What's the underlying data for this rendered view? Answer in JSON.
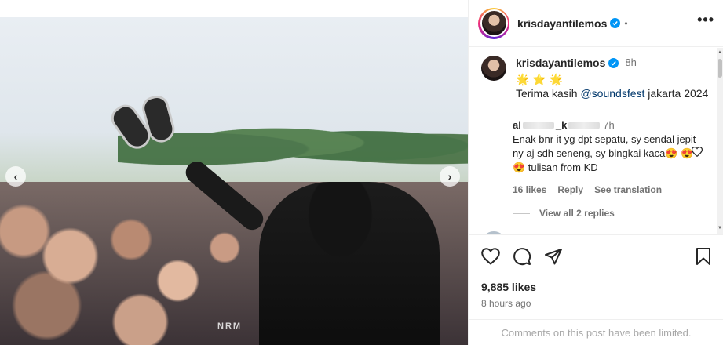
{
  "post": {
    "username": "krisdayantilemos",
    "header_dot": "•",
    "more_glyph": "•••",
    "photo_watermark": "NRM"
  },
  "caption": {
    "username": "krisdayantilemos",
    "time": "8h",
    "emojis": "🌟⭐🌟",
    "text_prefix": "Terima kasih ",
    "mention": "@soundsfest",
    "text_suffix": " jakarta 2024"
  },
  "reply": {
    "name_start": "al",
    "name_mid": "_k",
    "time": "7h",
    "text": "Enak bnr it yg dpt sepatu, sy sendal jepit ny aj sdh seneng, sy bingkai kaca😍 😍 😍 tulisan from KD",
    "likes": "16 likes",
    "reply_label": "Reply",
    "translate_label": "See translation"
  },
  "view_replies": "View all 2 replies",
  "stats": {
    "likes": "9,885 likes",
    "ago": "8 hours ago"
  },
  "footer": {
    "limited": "Comments on this post have been limited."
  },
  "nav": {
    "prev": "‹",
    "next": "›"
  },
  "icons": [
    "heart-icon",
    "comment-icon",
    "share-icon",
    "bookmark-icon",
    "verified-icon",
    "more-icon",
    "chevron-left-icon",
    "chevron-right-icon"
  ]
}
